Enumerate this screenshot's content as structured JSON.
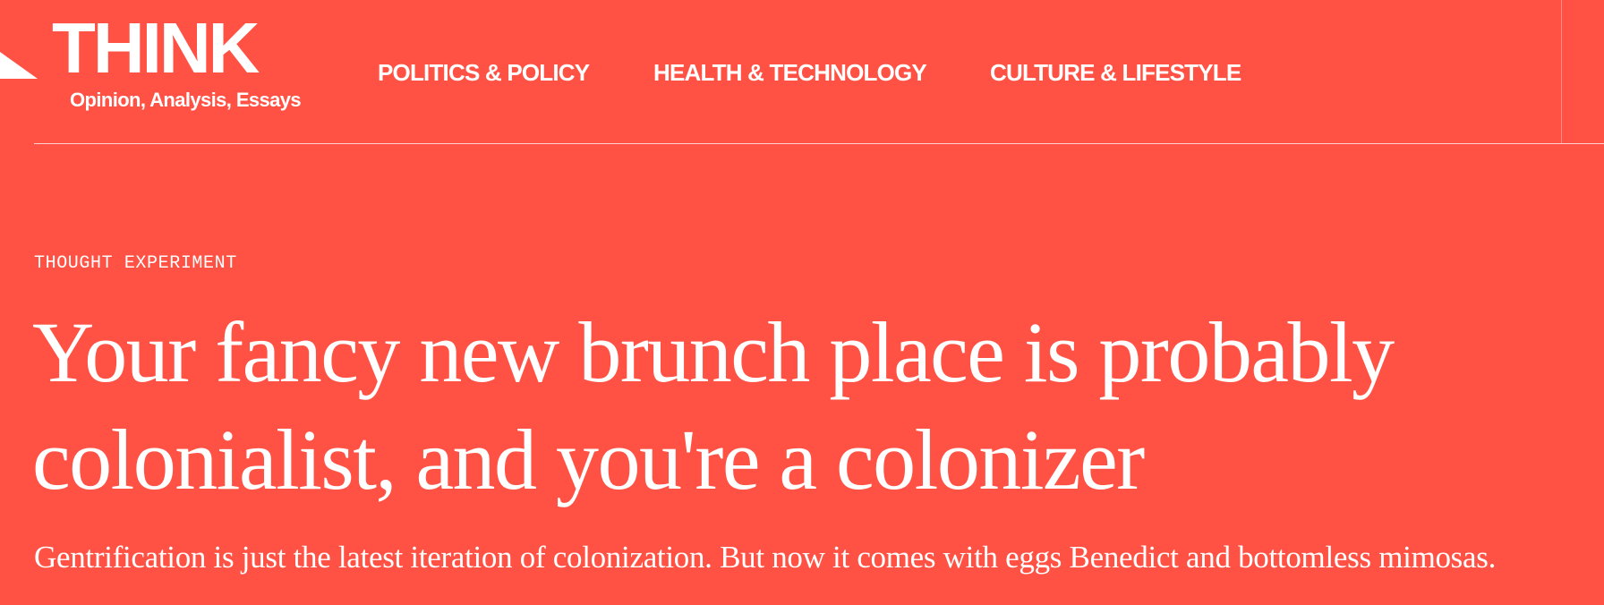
{
  "brand": {
    "logo_text": "THINK",
    "tagline": "Opinion, Analysis, Essays",
    "color": "#ff5244"
  },
  "nav": {
    "items": [
      {
        "label": "POLITICS & POLICY"
      },
      {
        "label": "HEALTH & TECHNOLOGY"
      },
      {
        "label": "CULTURE & LIFESTYLE"
      }
    ]
  },
  "article": {
    "category": "THOUGHT EXPERIMENT",
    "headline": "Your fancy new brunch place is probably colonialist, and you're a colonizer",
    "dek": "Gentrification is just the latest iteration of colonization. But now it comes with eggs Benedict and bottomless mimosas."
  }
}
